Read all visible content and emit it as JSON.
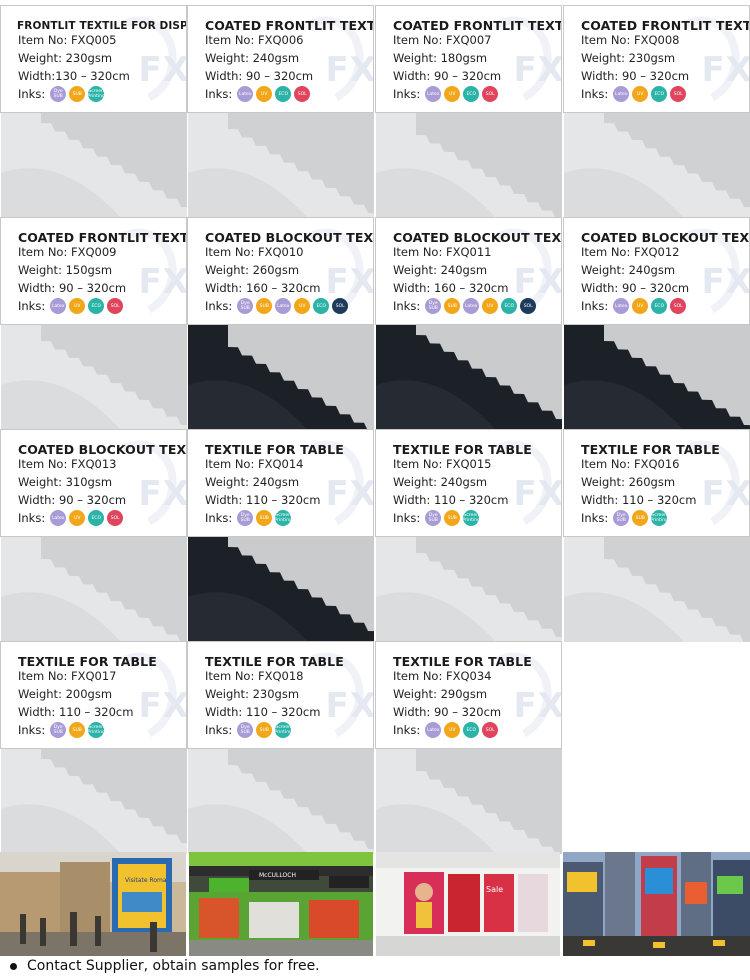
{
  "labels": {
    "item": "Item No: ",
    "weight": "Weight: ",
    "width": "Width: ",
    "inks": "Inks:"
  },
  "watermark": "FX",
  "ink_types": {
    "dye_sub": {
      "text": "Dye SUB",
      "color": "#a99bd6"
    },
    "sub": {
      "text": "SUB",
      "color": "#f2a71b"
    },
    "screen": {
      "text": "Screen Printing",
      "color": "#2bb3a8"
    },
    "latex": {
      "text": "Latex",
      "color": "#a99bd6"
    },
    "uv": {
      "text": "UV",
      "color": "#f2a71b"
    },
    "eco": {
      "text": "ECO",
      "color": "#2bb3a8"
    },
    "sol": {
      "text": "SOL",
      "color": "#e0455e"
    },
    "sol_dark": {
      "text": "SOL",
      "color": "#1e3b5c"
    }
  },
  "products": [
    {
      "title": "FRONTLIT TEXTILE FOR DISPLAY",
      "item": "FXQ005",
      "weight": "230gsm",
      "width_label": "Width:",
      "width": "130 – 320cm",
      "inks": [
        "dye_sub",
        "sub",
        "screen"
      ],
      "fabric": "light"
    },
    {
      "title": "COATED FRONTLIT TEXTILE",
      "item": "FXQ006",
      "weight": "240gsm",
      "width": "90 – 320cm",
      "inks": [
        "latex",
        "uv",
        "eco",
        "sol"
      ],
      "fabric": "light"
    },
    {
      "title": "COATED FRONTLIT TEXTILE",
      "item": "FXQ007",
      "weight": "180gsm",
      "width": "90 – 320cm",
      "inks": [
        "latex",
        "uv",
        "eco",
        "sol"
      ],
      "fabric": "light"
    },
    {
      "title": "COATED FRONTLIT TEXTILE",
      "item": "FXQ008",
      "weight": "230gsm",
      "width": "90 – 320cm",
      "inks": [
        "latex",
        "uv",
        "eco",
        "sol"
      ],
      "fabric": "light"
    },
    {
      "title": "COATED FRONTLIT TEXTILE",
      "item": "FXQ009",
      "weight": "150gsm",
      "width": "90 – 320cm",
      "inks": [
        "latex",
        "uv",
        "eco",
        "sol"
      ],
      "fabric": "light"
    },
    {
      "title": "COATED BLOCKOUT TEXTILE",
      "item": "FXQ010",
      "weight": "260gsm",
      "width": "160 – 320cm",
      "inks": [
        "dye_sub",
        "sub",
        "latex",
        "uv",
        "eco",
        "sol_dark"
      ],
      "fabric": "dark"
    },
    {
      "title": "COATED BLOCKOUT TEXTILE",
      "item": "FXQ011",
      "weight": "240gsm",
      "width": "160 – 320cm",
      "inks": [
        "dye_sub",
        "sub",
        "latex",
        "uv",
        "eco",
        "sol_dark"
      ],
      "fabric": "dark"
    },
    {
      "title": "COATED BLOCKOUT TEXTILE",
      "item": "FXQ012",
      "weight": "240gsm",
      "width": "90 – 320cm",
      "inks": [
        "latex",
        "uv",
        "eco",
        "sol"
      ],
      "fabric": "dark"
    },
    {
      "title": "COATED BLOCKOUT TEXTILE",
      "item": "FXQ013",
      "weight": "310gsm",
      "width": "90 – 320cm",
      "inks": [
        "latex",
        "uv",
        "eco",
        "sol"
      ],
      "fabric": "light"
    },
    {
      "title": "TEXTILE FOR TABLE",
      "item": "FXQ014",
      "weight": "240gsm",
      "width": "110 – 320cm",
      "inks": [
        "dye_sub",
        "sub",
        "screen"
      ],
      "fabric": "dark"
    },
    {
      "title": "TEXTILE FOR TABLE",
      "item": "FXQ015",
      "weight": "240gsm",
      "width": "110 – 320cm",
      "inks": [
        "dye_sub",
        "sub",
        "screen"
      ],
      "fabric": "light"
    },
    {
      "title": "TEXTILE FOR TABLE",
      "item": "FXQ016",
      "weight": "260gsm",
      "width": "110 – 320cm",
      "inks": [
        "dye_sub",
        "sub",
        "screen"
      ],
      "fabric": "light"
    },
    {
      "title": "TEXTILE FOR TABLE",
      "item": "FXQ017",
      "weight": "200gsm",
      "width": "110 – 320cm",
      "inks": [
        "dye_sub",
        "sub",
        "screen"
      ],
      "fabric": "light"
    },
    {
      "title": "TEXTILE FOR TABLE",
      "item": "FXQ018",
      "weight": "230gsm",
      "width": "110 – 320cm",
      "inks": [
        "dye_sub",
        "sub",
        "screen"
      ],
      "fabric": "light"
    },
    {
      "title": "TEXTILE FOR TABLE",
      "item": "FXQ034",
      "weight": "290gsm",
      "width": "90 – 320cm",
      "inks": [
        "latex",
        "uv",
        "eco",
        "sol"
      ],
      "fabric": "light"
    }
  ],
  "photos": [
    {
      "subject": "street-scene",
      "sign_text": "Visitate Roma"
    },
    {
      "subject": "store-interior",
      "sign_text": "McCULLOCH"
    },
    {
      "subject": "shop-window",
      "sign_text": "Sale"
    },
    {
      "subject": "times-square"
    }
  ],
  "footer": "Contact Supplier, obtain samples for free."
}
